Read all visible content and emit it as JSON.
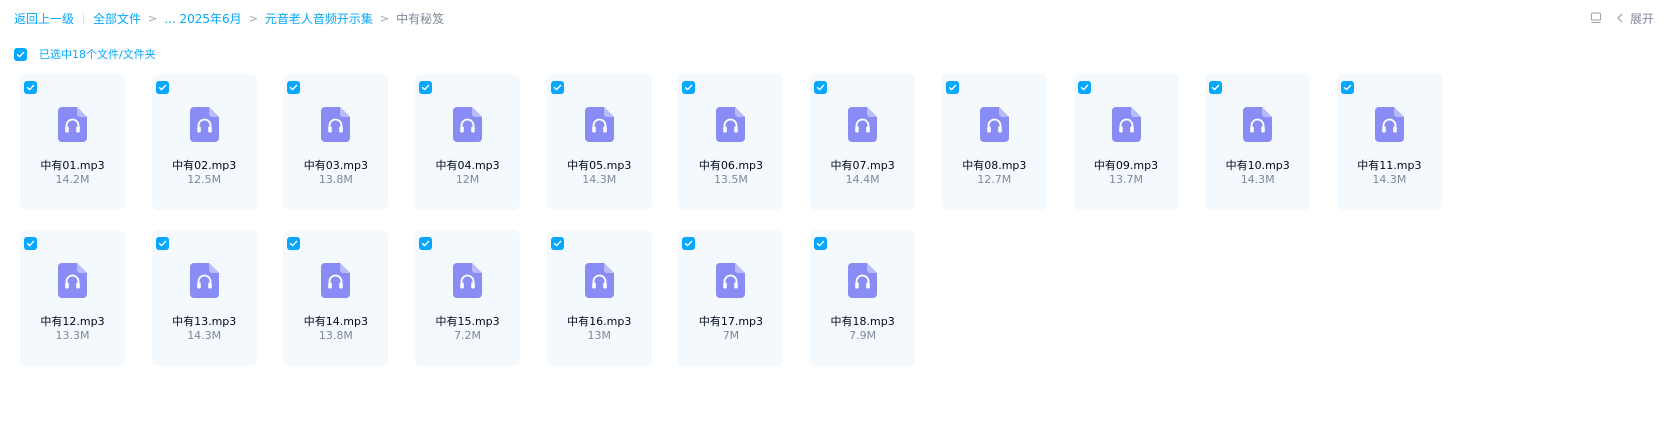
{
  "breadcrumb": {
    "back": "返回上一级",
    "all_files": "全部文件",
    "ellipsis_segment": "... 2025年6月",
    "parent_folder": "元音老人音频开示集",
    "current": "中有秘笈"
  },
  "toolbar": {
    "expand_label": "展开",
    "icons": [
      "panel-icon",
      "chevron-left-icon"
    ]
  },
  "selection": {
    "label": "已选中18个文件/文件夹",
    "all_checked": true
  },
  "colors": {
    "accent": "#06a7ff",
    "card_bg": "#f3f9fc",
    "file_icon": "#8a8cf5"
  },
  "files": [
    {
      "name": "中有01.mp3",
      "size": "14.2M",
      "icon": "audio-file-icon",
      "checked": true
    },
    {
      "name": "中有02.mp3",
      "size": "12.5M",
      "icon": "audio-file-icon",
      "checked": true
    },
    {
      "name": "中有03.mp3",
      "size": "13.8M",
      "icon": "audio-file-icon",
      "checked": true
    },
    {
      "name": "中有04.mp3",
      "size": "12M",
      "icon": "audio-file-icon",
      "checked": true
    },
    {
      "name": "中有05.mp3",
      "size": "14.3M",
      "icon": "audio-file-icon",
      "checked": true
    },
    {
      "name": "中有06.mp3",
      "size": "13.5M",
      "icon": "audio-file-icon",
      "checked": true
    },
    {
      "name": "中有07.mp3",
      "size": "14.4M",
      "icon": "audio-file-icon",
      "checked": true
    },
    {
      "name": "中有08.mp3",
      "size": "12.7M",
      "icon": "audio-file-icon",
      "checked": true
    },
    {
      "name": "中有09.mp3",
      "size": "13.7M",
      "icon": "audio-file-icon",
      "checked": true
    },
    {
      "name": "中有10.mp3",
      "size": "14.3M",
      "icon": "audio-file-icon",
      "checked": true
    },
    {
      "name": "中有11.mp3",
      "size": "14.3M",
      "icon": "audio-file-icon",
      "checked": true
    },
    {
      "name": "中有12.mp3",
      "size": "13.3M",
      "icon": "audio-file-icon",
      "checked": true
    },
    {
      "name": "中有13.mp3",
      "size": "14.3M",
      "icon": "audio-file-icon",
      "checked": true
    },
    {
      "name": "中有14.mp3",
      "size": "13.8M",
      "icon": "audio-file-icon",
      "checked": true
    },
    {
      "name": "中有15.mp3",
      "size": "7.2M",
      "icon": "audio-file-icon",
      "checked": true
    },
    {
      "name": "中有16.mp3",
      "size": "13M",
      "icon": "audio-file-icon",
      "checked": true
    },
    {
      "name": "中有17.mp3",
      "size": "7M",
      "icon": "audio-file-icon",
      "checked": true
    },
    {
      "name": "中有18.mp3",
      "size": "7.9M",
      "icon": "audio-file-icon",
      "checked": true
    }
  ]
}
